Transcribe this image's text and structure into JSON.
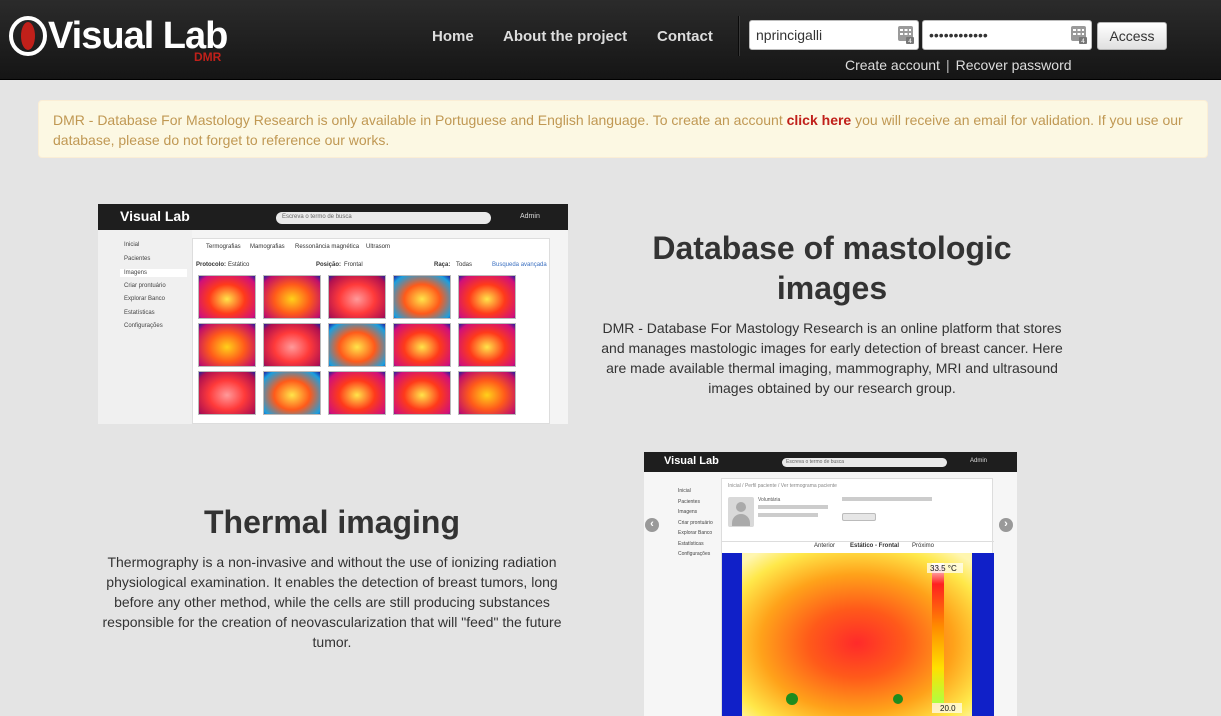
{
  "brand": {
    "name": "Visual Lab",
    "subname": "DMR"
  },
  "nav": {
    "home": "Home",
    "about": "About the project",
    "contact": "Contact"
  },
  "login": {
    "username": "nprincigalli",
    "password": "••••••••••••",
    "access": "Access",
    "create_account": "Create account",
    "separator": "|",
    "recover_password": "Recover password"
  },
  "alert": {
    "text_before": "DMR - Database For Mastology Research is only available in Portuguese and English language. To create an account ",
    "link": "click here",
    "text_after": " you will receive an email for validation. If you use our database, please do not forget to reference our works."
  },
  "section1": {
    "title": "Database of mastologic images",
    "text": "DMR - Database For Mastology Research is an online platform that stores and manages mastologic images for early detection of breast cancer. Here are made available thermal imaging, mammography, MRI and ultrasound images obtained by our research group."
  },
  "section2": {
    "title": "Thermal imaging",
    "text": "Thermography is a non-invasive and without the use of ionizing radiation physiological examination. It enables the detection of breast tumors, long before any other method, while the cells are still producing substances responsible for the creation of neovascularization that will \"feed\" the future tumor."
  },
  "shot1": {
    "logo": "Visual Lab",
    "search": "Escreva o termo de busca",
    "user": "Admin",
    "tabs": [
      "Termografias",
      "Mamografias",
      "Ressonância magnética",
      "Ultrasom"
    ],
    "sidebar": [
      "Inicial",
      "Pacientes",
      "Imagens",
      "Criar prontuário",
      "Explorar Banco",
      "Estatísticas",
      "Configurações"
    ],
    "filters": [
      "Protocolo:",
      "Estático",
      "Posição:",
      "Frontal",
      "Raça:",
      "Todas",
      "Busqueda avançada"
    ]
  },
  "shot2": {
    "logo": "Visual Lab",
    "search": "Escreva o termo de busca",
    "user": "Admin",
    "sidebar": [
      "Inicial",
      "Pacientes",
      "Imagens",
      "Criar prontuário",
      "Explorar Banco",
      "Estatísticas",
      "Configurações"
    ],
    "breadcrumb": "Inicial / Perfil paciente / Ver termograma paciente",
    "patient_label": "Voluntária",
    "mode_label": "Estático - Frontal",
    "prev": "Anterior",
    "next": "Próximo",
    "temp_max": "33.5 °C",
    "temp_min": "20.0"
  },
  "colors": {
    "navbar": "#1e1e1e",
    "alert_bg": "#fcf8e3",
    "alert_text": "#c09853",
    "alert_link": "#c0201a",
    "brand_accent": "#c0201a"
  },
  "icons": {
    "keypad": "virtual-keyboard-icon",
    "prev": "chevron-left-icon",
    "next": "chevron-right-icon"
  }
}
